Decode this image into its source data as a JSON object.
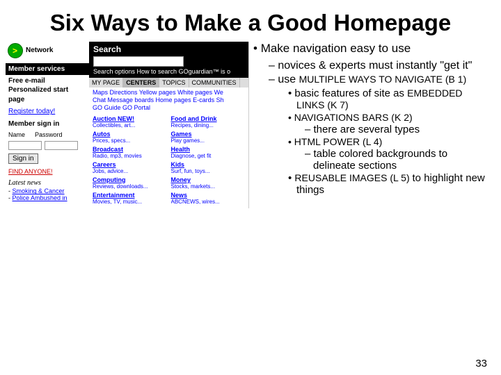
{
  "title": "Six Ways to Make a Good Homepage",
  "bullets": {
    "b1": "Make navigation easy to use",
    "b2a": "novices & experts must instantly \"get it\"",
    "b2b_pre": "use ",
    "b2b_main": "MULTIPLE WAYS TO NAVIGATE (B 1)",
    "b3a_pre": "basic features of site as ",
    "b3a_main": "EMBEDDED LINKS (K 7)",
    "b3b": "NAVIGATIONS BARS (K 2)",
    "b4b": "there are several types",
    "b3c": "HTML POWER (L 4)",
    "b4c": "table colored backgrounds to delineate sections",
    "b3d_pre": "REUSABLE IMAGES (L 5) ",
    "b3d_main": "to highlight new things"
  },
  "page_number": "33",
  "shot": {
    "network_label": "Network",
    "member_head": "Member services",
    "member_items": [
      "Free e-mail",
      "Personalized start page"
    ],
    "register": "Register today!",
    "signin_head": "Member sign in",
    "signin_labels": [
      "Name",
      "Password"
    ],
    "signin_btn": "Sign in",
    "promo": "FIND ANYONE!",
    "news_head": "Latest news",
    "news_items": [
      "Smoking & Cancer",
      "Police Ambushed in"
    ],
    "search_label": "Search",
    "search_opts": "Search options   How to search   GOguardian™ is o",
    "tabs": [
      "MY PAGE",
      "CENTERS",
      "TOPICS",
      "COMMUNITIES"
    ],
    "quicklinks_l1": "Maps  Directions  Yellow pages  White pages  We",
    "quicklinks_l2": "Chat  Message boards  Home pages  E-cards  Sh",
    "quicklinks_l3": "GO Guide  GO Portal",
    "cats": [
      {
        "h": "Auction NEW!",
        "s": "Collectibles, art..."
      },
      {
        "h": "Autos",
        "s": "Prices, specs..."
      },
      {
        "h": "Broadcast",
        "s": "Radio, mp3, movies"
      },
      {
        "h": "Careers",
        "s": "Jobs, advice..."
      },
      {
        "h": "Computing",
        "s": "Reviews, downloads..."
      },
      {
        "h": "Entertainment",
        "s": "Movies, TV, music..."
      }
    ],
    "cats2": [
      {
        "h": "Food and Drink",
        "s": "Recipes, dining..."
      },
      {
        "h": "Games",
        "s": "Play games..."
      },
      {
        "h": "Health",
        "s": "Diagnose, get fit"
      },
      {
        "h": "Kids",
        "s": "Surf, fun, toys..."
      },
      {
        "h": "Money",
        "s": "Stocks, markets..."
      },
      {
        "h": "News",
        "s": "ABCNEWS, wires..."
      }
    ]
  }
}
